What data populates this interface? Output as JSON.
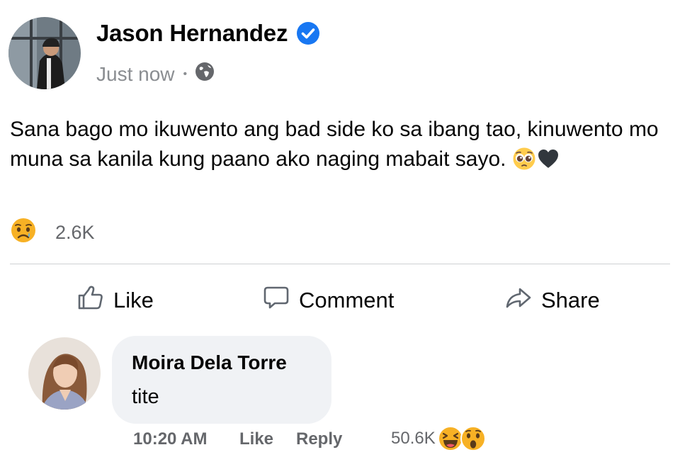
{
  "post": {
    "author": "Jason Hernandez",
    "verified_icon": "verified-badge-icon",
    "timestamp": "Just now",
    "separator": "•",
    "audience_icon": "globe-icon",
    "text": "Sana bago mo ikuwento ang bad side ko sa ibang tao, kinuwento mo muna sa kanila kung paano ako naging mabait sayo.",
    "text_emojis": [
      "pleading-face-emoji",
      "black-heart-emoji"
    ],
    "reaction_icon": "sad-reaction-icon",
    "reaction_count": "2.6K"
  },
  "actions": {
    "like": "Like",
    "comment": "Comment",
    "share": "Share"
  },
  "comment": {
    "author": "Moira Dela Torre",
    "text": "tite",
    "time": "10:20 AM",
    "like": "Like",
    "reply": "Reply",
    "reaction_count": "50.6K",
    "reaction_icons": [
      "haha-reaction-icon",
      "wow-reaction-icon"
    ]
  },
  "colors": {
    "verified_blue": "#1877f2",
    "muted_text": "#65676b",
    "bubble_bg": "#f0f2f5",
    "reaction_yellow": "#f7b125"
  }
}
